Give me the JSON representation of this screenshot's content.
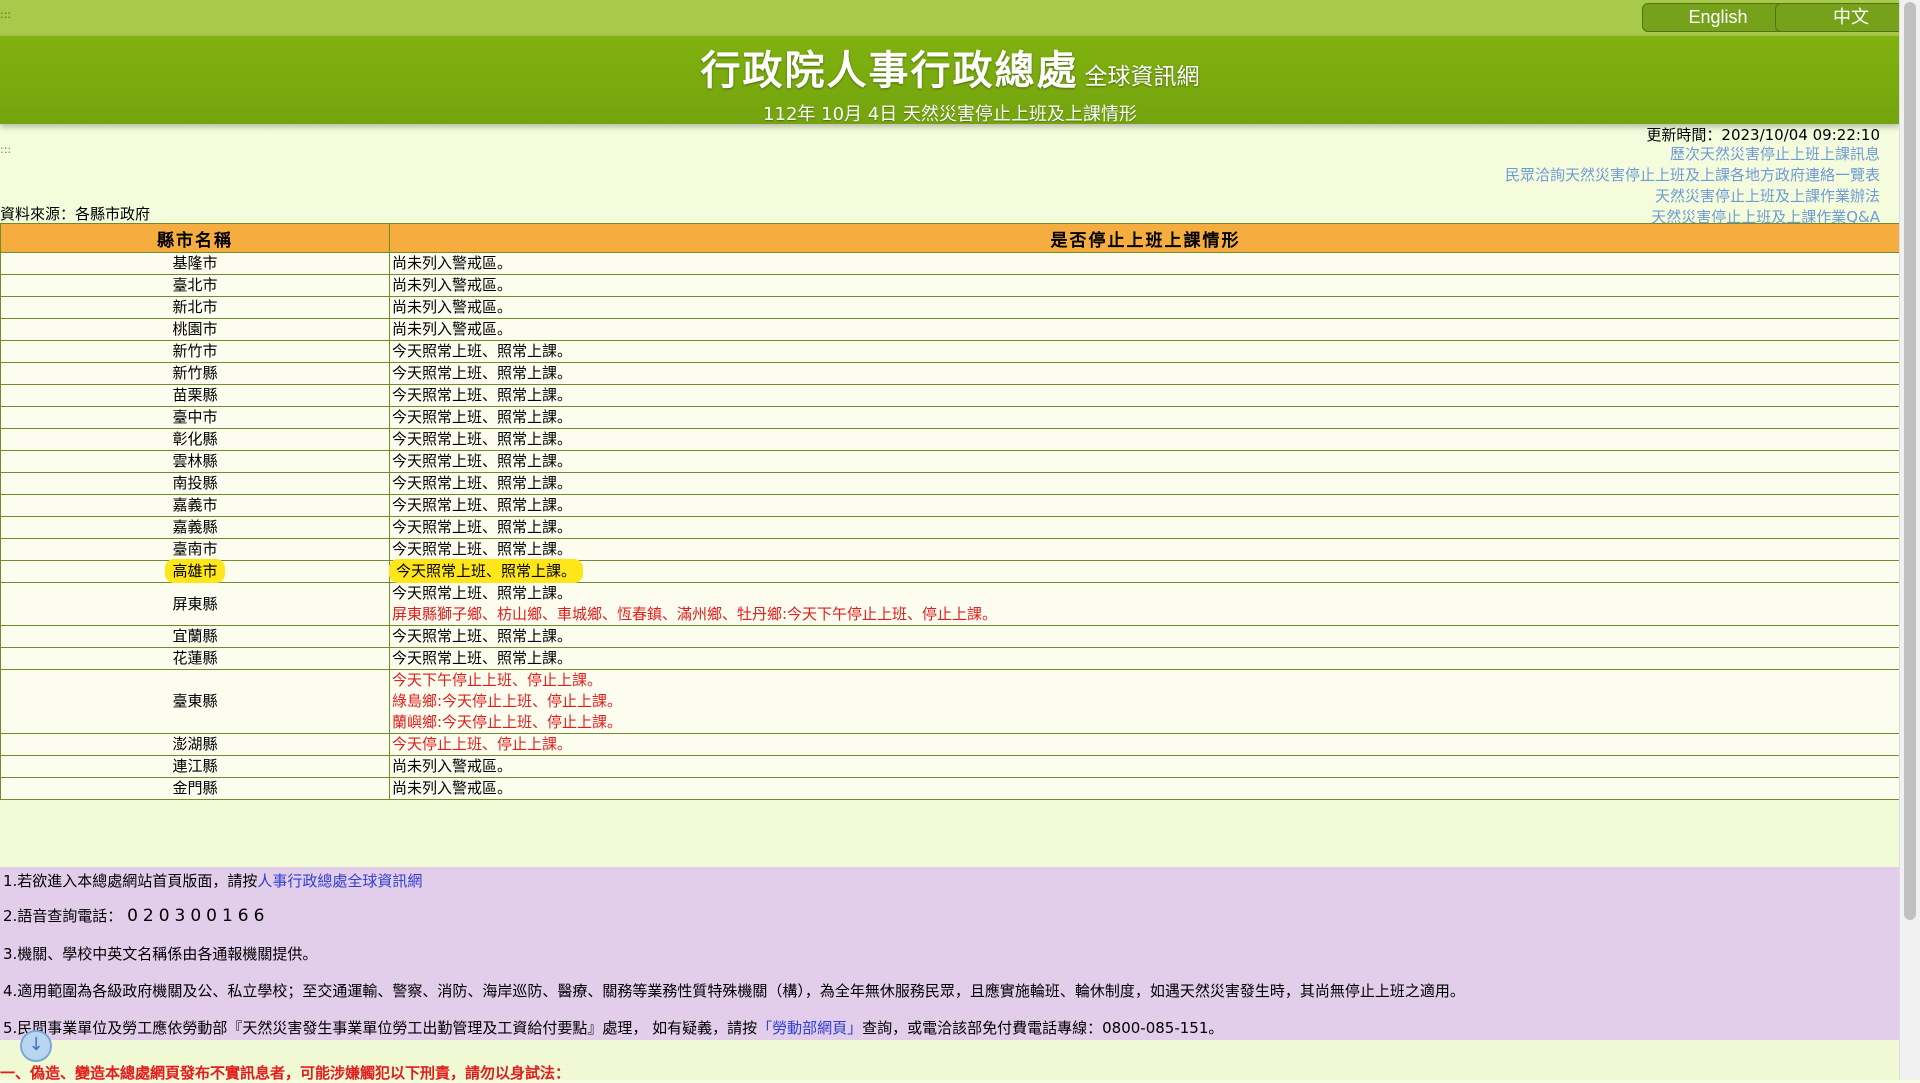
{
  "header": {
    "dots_left": ":::",
    "lang_english": "English",
    "lang_chinese": "中文",
    "site_title": "行政院人事行政總處",
    "site_subtitle": "全球資訊網",
    "date_line": "112年 10月 4日 天然災害停止上班及上課情形"
  },
  "meta": {
    "updated": "更新時間：2023/10/04 09:22:10",
    "dots_mid": ":::",
    "source": "資料來源：各縣市政府",
    "links": [
      "歷次天然災害停止上班上課訊息",
      "民眾洽詢天然災害停止上班及上課各地方政府連絡一覽表",
      "天然災害停止上班及上課作業辦法",
      "天然災害停止上班及上課作業Q&A"
    ]
  },
  "table": {
    "headers": [
      "縣市名稱",
      "是否停止上班上課情形"
    ],
    "rows": [
      {
        "city": "基隆市",
        "lines": [
          {
            "text": "尚未列入警戒區。",
            "color": "normal"
          }
        ]
      },
      {
        "city": "臺北市",
        "lines": [
          {
            "text": "尚未列入警戒區。",
            "color": "normal"
          }
        ]
      },
      {
        "city": "新北市",
        "lines": [
          {
            "text": "尚未列入警戒區。",
            "color": "normal"
          }
        ]
      },
      {
        "city": "桃園市",
        "lines": [
          {
            "text": "尚未列入警戒區。",
            "color": "normal"
          }
        ]
      },
      {
        "city": "新竹市",
        "lines": [
          {
            "text": "今天照常上班、照常上課。",
            "color": "normal"
          }
        ]
      },
      {
        "city": "新竹縣",
        "lines": [
          {
            "text": "今天照常上班、照常上課。",
            "color": "normal"
          }
        ]
      },
      {
        "city": "苗栗縣",
        "lines": [
          {
            "text": "今天照常上班、照常上課。",
            "color": "normal"
          }
        ]
      },
      {
        "city": "臺中市",
        "lines": [
          {
            "text": "今天照常上班、照常上課。",
            "color": "normal"
          }
        ]
      },
      {
        "city": "彰化縣",
        "lines": [
          {
            "text": "今天照常上班、照常上課。",
            "color": "normal"
          }
        ]
      },
      {
        "city": "雲林縣",
        "lines": [
          {
            "text": "今天照常上班、照常上課。",
            "color": "normal"
          }
        ]
      },
      {
        "city": "南投縣",
        "lines": [
          {
            "text": "今天照常上班、照常上課。",
            "color": "normal"
          }
        ]
      },
      {
        "city": "嘉義市",
        "lines": [
          {
            "text": "今天照常上班、照常上課。",
            "color": "normal"
          }
        ]
      },
      {
        "city": "嘉義縣",
        "lines": [
          {
            "text": "今天照常上班、照常上課。",
            "color": "normal"
          }
        ]
      },
      {
        "city": "臺南市",
        "lines": [
          {
            "text": "今天照常上班、照常上課。",
            "color": "normal"
          }
        ]
      },
      {
        "city": "高雄市",
        "highlight": true,
        "lines": [
          {
            "text": "今天照常上班、照常上課。",
            "color": "normal"
          }
        ]
      },
      {
        "city": "屏東縣",
        "lines": [
          {
            "text": "今天照常上班、照常上課。",
            "color": "normal"
          },
          {
            "text": "屏東縣獅子鄉、枋山鄉、車城鄉、恆春鎮、滿州鄉、牡丹鄉:今天下午停止上班、停止上課。",
            "color": "red"
          }
        ]
      },
      {
        "city": "宜蘭縣",
        "lines": [
          {
            "text": "今天照常上班、照常上課。",
            "color": "normal"
          }
        ]
      },
      {
        "city": "花蓮縣",
        "lines": [
          {
            "text": "今天照常上班、照常上課。",
            "color": "normal"
          }
        ]
      },
      {
        "city": "臺東縣",
        "lines": [
          {
            "text": "今天下午停止上班、停止上課。",
            "color": "red"
          },
          {
            "text": "綠島鄉:今天停止上班、停止上課。",
            "color": "red"
          },
          {
            "text": "蘭嶼鄉:今天停止上班、停止上課。",
            "color": "red"
          }
        ]
      },
      {
        "city": "澎湖縣",
        "lines": [
          {
            "text": "今天停止上班、停止上課。",
            "color": "red"
          }
        ]
      },
      {
        "city": "連江縣",
        "lines": [
          {
            "text": "尚未列入警戒區。",
            "color": "normal"
          }
        ]
      },
      {
        "city": "金門縣",
        "lines": [
          {
            "text": "尚未列入警戒區。",
            "color": "normal"
          }
        ]
      }
    ]
  },
  "notes": {
    "n1_prefix": "1.若欲進入本總處網站首頁版面，請按",
    "n1_link": "人事行政總處全球資訊網",
    "n2_prefix": "2.語音查詢電話：",
    "n2_phone": "020300166",
    "n3": "3.機關、學校中英文名稱係由各通報機關提供。",
    "n4": "4.適用範圍為各級政府機關及公、私立學校；至交通運輸、警察、消防、海岸巡防、醫療、關務等業務性質特殊機關（構），為全年無休服務民眾，且應實施輪班、輪休制度，如遇天然災害發生時，其尚無停止上班之適用。",
    "n5_prefix": "5.民間事業單位及勞工應依勞動部『天然災害發生事業單位勞工出勤管理及工資給付要點』處理， 如有疑義，請按",
    "n5_link": "「勞動部網頁」",
    "n5_suffix": "查詢，或電洽該部免付費電話專線：0800-085-151。"
  },
  "warning": "一、偽造、變造本總處網頁發布不實訊息者，可能涉嫌觸犯以下刑責，請勿以身試法："
}
